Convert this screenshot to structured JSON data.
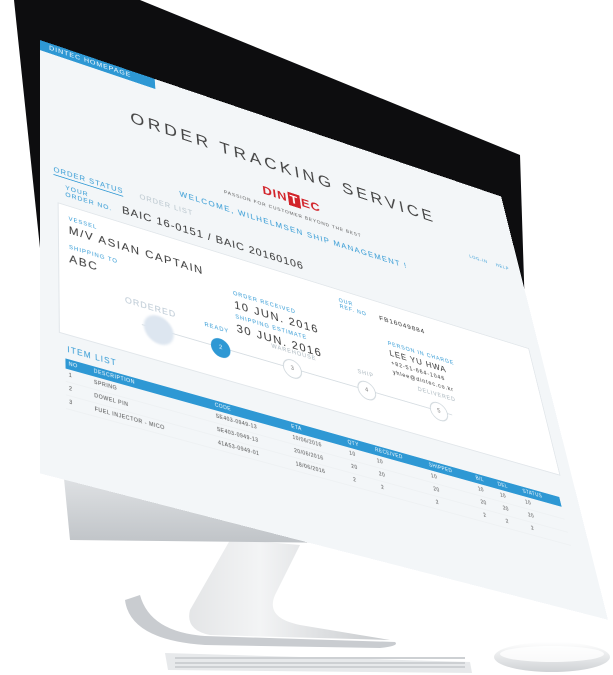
{
  "tabs": {
    "home": "DINTEC HOMEPAGE"
  },
  "top_links": [
    "LOG-IN",
    "HELP"
  ],
  "hero": {
    "title": "ORDER TRACKING SERVICE",
    "logo_text": [
      "DIN",
      "T",
      "EC"
    ],
    "tagline": "PASSION FOR CUSTOMER BEYOND THE BEST",
    "welcome": "WELCOME, WILHELMSEN SHIP MANAGEMENT !"
  },
  "subtabs": {
    "active": "ORDER STATUS",
    "other": "ORDER LIST"
  },
  "order": {
    "no_label_1": "YOUR",
    "no_label_2": "ORDER NO.",
    "no_value": "BAIC 16-0151 / BAIC 20160106",
    "vessel_label": "VESSEL",
    "vessel": "M/V ASIAN CAPTAIN",
    "ref_label_1": "OUR",
    "ref_label_2": "REF. NO",
    "ref": "FB16049884",
    "shipping_to_label": "SHIPPING TO",
    "shipping_to": "ABC",
    "received_label": "ORDER RECEIVED",
    "received": "10 JUN. 2016",
    "estimate_label": "SHIPPING ESTIMATE",
    "estimate": "30 JUN. 2016",
    "person_label": "PERSON IN CHARGE",
    "person": "LEE YU HWA",
    "phone": "+82-51-664-1046",
    "email": "yhlee@dintec.co.kr"
  },
  "steps": [
    {
      "label": "ORDERED",
      "num": "",
      "state": "done"
    },
    {
      "label": "READY",
      "num": "2",
      "state": "current"
    },
    {
      "label": "WAREHOUSE",
      "num": "3",
      "state": "todo"
    },
    {
      "label": "SHIP",
      "num": "4",
      "state": "todo"
    },
    {
      "label": "DELIVERED",
      "num": "5",
      "state": "todo"
    }
  ],
  "items": {
    "title": "ITEM LIST",
    "headers": [
      "NO",
      "DESCRIPTION",
      "CODE",
      "ETA",
      "QTY",
      "RECEIVED",
      "SHIPPED",
      "B/L",
      "DEL",
      "STATUS"
    ],
    "rows": [
      [
        "1",
        "SPRING",
        "SE403-0949-13",
        "10/06/2016",
        "10",
        "10",
        "10",
        "10",
        "10",
        "10"
      ],
      [
        "2",
        "DOWEL PIN",
        "SE403-0949-13",
        "20/06/2016",
        "20",
        "20",
        "20",
        "20",
        "20",
        "20"
      ],
      [
        "3",
        "FUEL INJECTOR - MICO",
        "41A53-0949-01",
        "18/06/2016",
        "2",
        "2",
        "2",
        "2",
        "2",
        "2"
      ]
    ]
  },
  "colors": {
    "accent": "#2e98d4",
    "brand_red": "#d2232a"
  }
}
